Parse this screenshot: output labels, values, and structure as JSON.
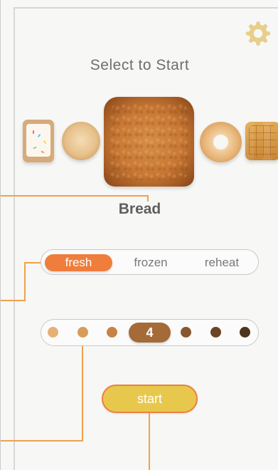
{
  "header": {
    "title": "Select to Start",
    "settings_icon": "gear-icon",
    "settings_color": "#e7cf8b"
  },
  "food_carousel": {
    "items": [
      {
        "name": "Pop Tart"
      },
      {
        "name": "English Muffin"
      },
      {
        "name": "Bread"
      },
      {
        "name": "Bagel"
      },
      {
        "name": "Waffle"
      }
    ],
    "selected_label": "Bread"
  },
  "mode_selector": {
    "options": [
      "fresh",
      "frozen",
      "reheat"
    ],
    "selected": "fresh",
    "accent": "#ef7d3c"
  },
  "shade_selector": {
    "selected_value": "4",
    "colors": [
      "#e6b175",
      "#d99b58",
      "#c98246",
      "#a46a37",
      "#87582e",
      "#6b4426",
      "#4f331d"
    ],
    "selected_color": "#a46a37"
  },
  "actions": {
    "start_label": "start",
    "start_color": "#e8c84c"
  },
  "callout_color": "#f0a14f"
}
